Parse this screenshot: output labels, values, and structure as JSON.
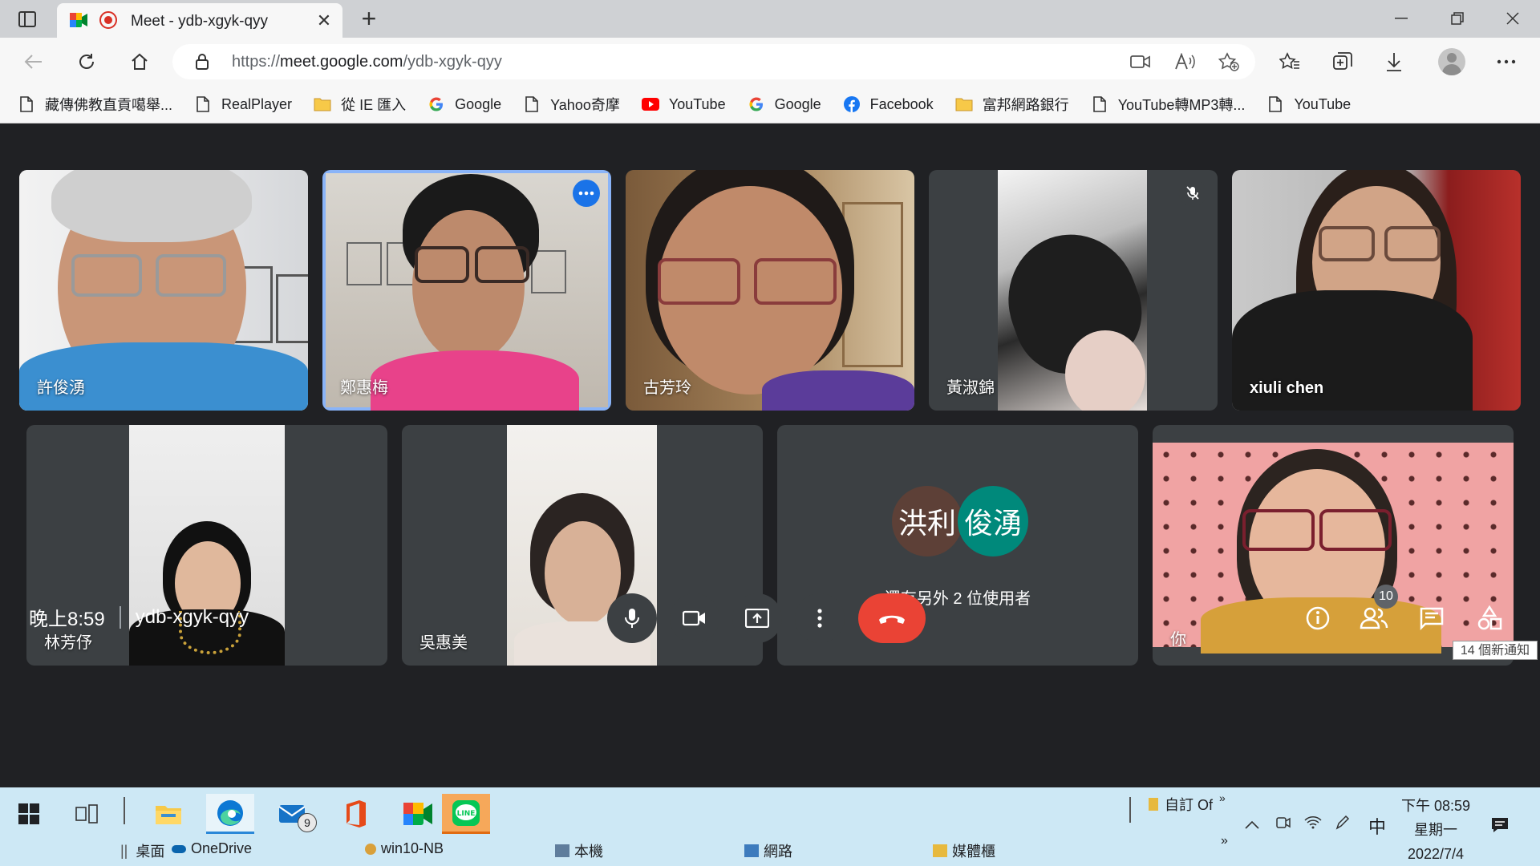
{
  "browser": {
    "tab_title": "Meet - ydb-xgyk-qyy",
    "url_prefix": "https://",
    "url_domain": "meet.google.com",
    "url_path": "/ydb-xgyk-qyy"
  },
  "bookmarks": [
    {
      "label": "藏傳佛教直貢噶舉...",
      "icon": "page-icon"
    },
    {
      "label": "RealPlayer",
      "icon": "page-icon"
    },
    {
      "label": "從 IE 匯入",
      "icon": "folder-icon"
    },
    {
      "label": "Google",
      "icon": "google-icon"
    },
    {
      "label": "Yahoo奇摩",
      "icon": "page-icon"
    },
    {
      "label": "YouTube",
      "icon": "youtube-icon"
    },
    {
      "label": "Google",
      "icon": "google-icon"
    },
    {
      "label": "Facebook",
      "icon": "facebook-icon"
    },
    {
      "label": "富邦網路銀行",
      "icon": "folder-icon"
    },
    {
      "label": "YouTube轉MP3轉...",
      "icon": "page-icon"
    },
    {
      "label": "YouTube",
      "icon": "page-icon"
    }
  ],
  "participants": {
    "p1": "許俊湧",
    "p2": "鄭惠梅",
    "p3": "古芳玲",
    "p4": "黃淑錦",
    "p5": "xiuli chen",
    "p6": "林芳伃",
    "p7": "吳惠美",
    "others_avatar_1": "洪利",
    "others_avatar_2": "俊湧",
    "others_text": "還有另外 2 位使用者",
    "self": "你"
  },
  "meeting": {
    "time": "晚上8:59",
    "code": "ydb-xgyk-qyy",
    "people_count": "10",
    "notification_tip": "14 個新通知"
  },
  "taskbar": {
    "mail_badge": "9",
    "labels": [
      "桌面",
      "OneDrive",
      "win10-NB",
      "本機",
      "網路",
      "媒體櫃"
    ],
    "tray_folder": "自訂 Of",
    "tray_ime": "中",
    "clock_time": "下午 08:59",
    "clock_day": "星期一",
    "clock_date": "2022/7/4"
  },
  "colors": {
    "meet_bg": "#202124",
    "tile_bg": "#3c4043",
    "end_call": "#ea4335",
    "active_speaker": "#8ab4f8",
    "avatar_brown": "#5d4037",
    "avatar_teal": "#00897b",
    "taskbar_bg": "#cde8f5"
  }
}
